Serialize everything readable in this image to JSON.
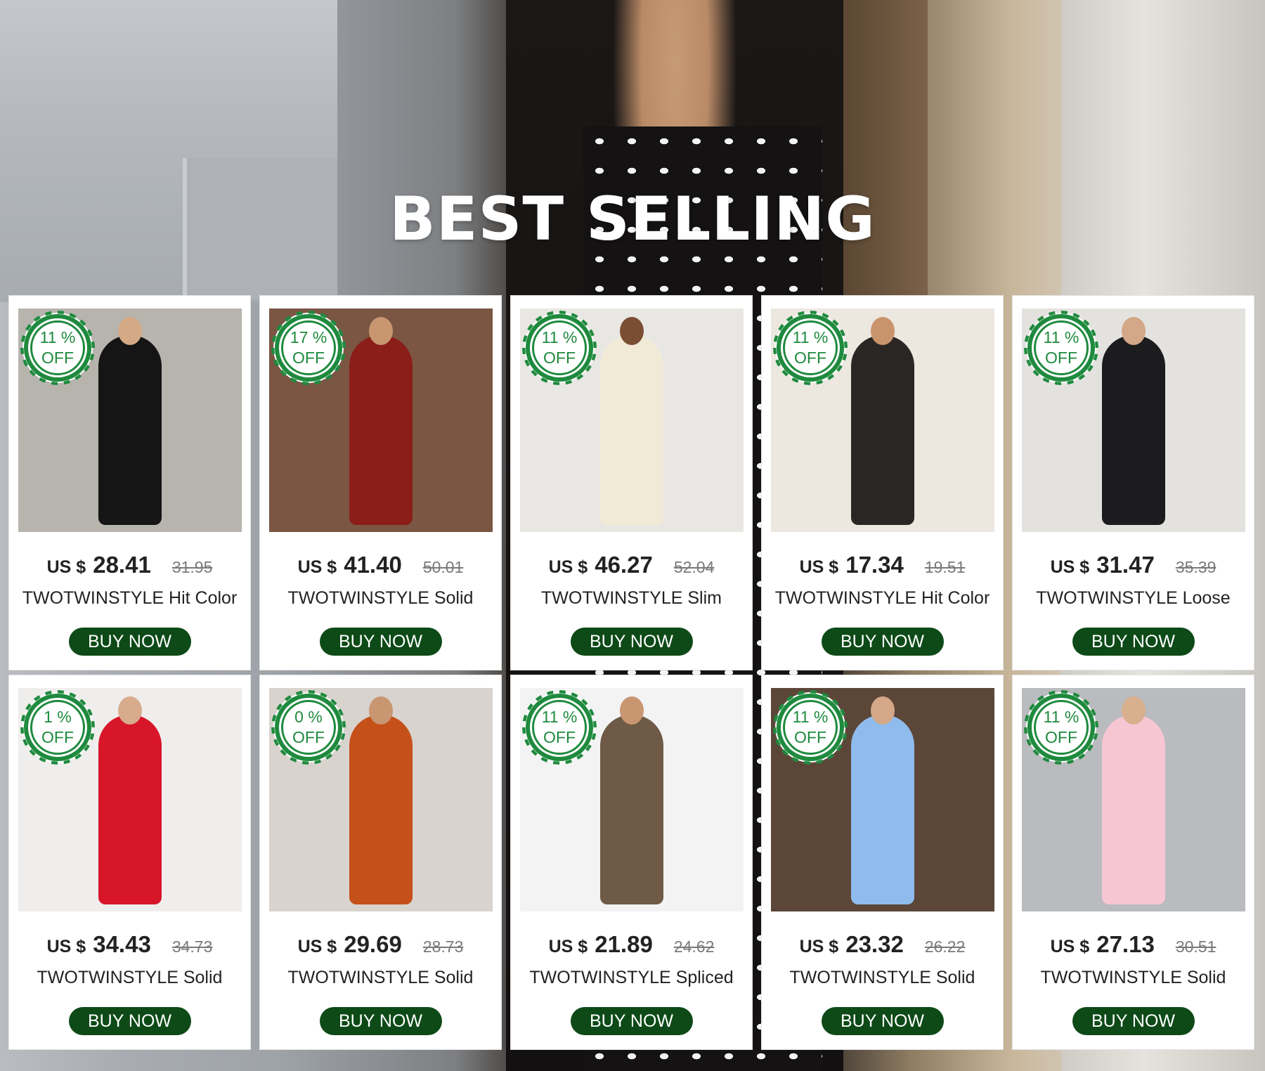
{
  "section_title": "BEST SELLING",
  "colors": {
    "badge_green": "#1f8a3e",
    "button_green": "#0d4a17"
  },
  "products": [
    {
      "discount_line1": "11 %",
      "discount_line2": "OFF",
      "currency": "US $",
      "price": "28.41",
      "old_price": "31.95",
      "name": "TWOTWINSTYLE Hit Color",
      "button": "BUY NOW",
      "bg": "#b7b4ae",
      "dress": "#151515",
      "skin": "#d4a985"
    },
    {
      "discount_line1": "17 %",
      "discount_line2": "OFF",
      "currency": "US $",
      "price": "41.40",
      "old_price": "50.01",
      "name": "TWOTWINSTYLE Solid",
      "button": "BUY NOW",
      "bg": "#7a5643",
      "dress": "#8b1e18",
      "skin": "#c99672"
    },
    {
      "discount_line1": "11 %",
      "discount_line2": "OFF",
      "currency": "US $",
      "price": "46.27",
      "old_price": "52.04",
      "name": "TWOTWINSTYLE Slim",
      "button": "BUY NOW",
      "bg": "#e9e7e3",
      "dress": "#f1ead7",
      "skin": "#7a4e33"
    },
    {
      "discount_line1": "11 %",
      "discount_line2": "OFF",
      "currency": "US $",
      "price": "17.34",
      "old_price": "19.51",
      "name": "TWOTWINSTYLE Hit Color",
      "button": "BUY NOW",
      "bg": "#ece8e0",
      "dress": "#2a2624",
      "skin": "#c9946b"
    },
    {
      "discount_line1": "11 %",
      "discount_line2": "OFF",
      "currency": "US $",
      "price": "31.47",
      "old_price": "35.39",
      "name": "TWOTWINSTYLE Loose",
      "button": "BUY NOW",
      "bg": "#e4e2df",
      "dress": "#1c1c1e",
      "skin": "#d3a787"
    },
    {
      "discount_line1": "1 %",
      "discount_line2": "OFF",
      "currency": "US $",
      "price": "34.43",
      "old_price": "34.73",
      "name": "TWOTWINSTYLE Solid",
      "button": "BUY NOW",
      "bg": "#f0eeec",
      "dress": "#d8162a",
      "skin": "#d7ab8c"
    },
    {
      "discount_line1": "0 %",
      "discount_line2": "OFF",
      "currency": "US $",
      "price": "29.69",
      "old_price": "28.73",
      "name": "TWOTWINSTYLE Solid",
      "button": "BUY NOW",
      "bg": "#d8d3cd",
      "dress": "#c5501a",
      "skin": "#c99672"
    },
    {
      "discount_line1": "11 %",
      "discount_line2": "OFF",
      "currency": "US $",
      "price": "21.89",
      "old_price": "24.62",
      "name": "TWOTWINSTYLE Spliced",
      "button": "BUY NOW",
      "bg": "#f3f3f3",
      "dress": "#6e5a46",
      "skin": "#c99672"
    },
    {
      "discount_line1": "11 %",
      "discount_line2": "OFF",
      "currency": "US $",
      "price": "23.32",
      "old_price": "26.22",
      "name": "TWOTWINSTYLE Solid",
      "button": "BUY NOW",
      "bg": "#5b4638",
      "dress": "#8fbcec",
      "skin": "#d3a787"
    },
    {
      "discount_line1": "11 %",
      "discount_line2": "OFF",
      "currency": "US $",
      "price": "27.13",
      "old_price": "30.51",
      "name": "TWOTWINSTYLE Solid",
      "button": "BUY NOW",
      "bg": "#b9bbbf",
      "dress": "#f6c6d3",
      "skin": "#d9b08e"
    }
  ]
}
